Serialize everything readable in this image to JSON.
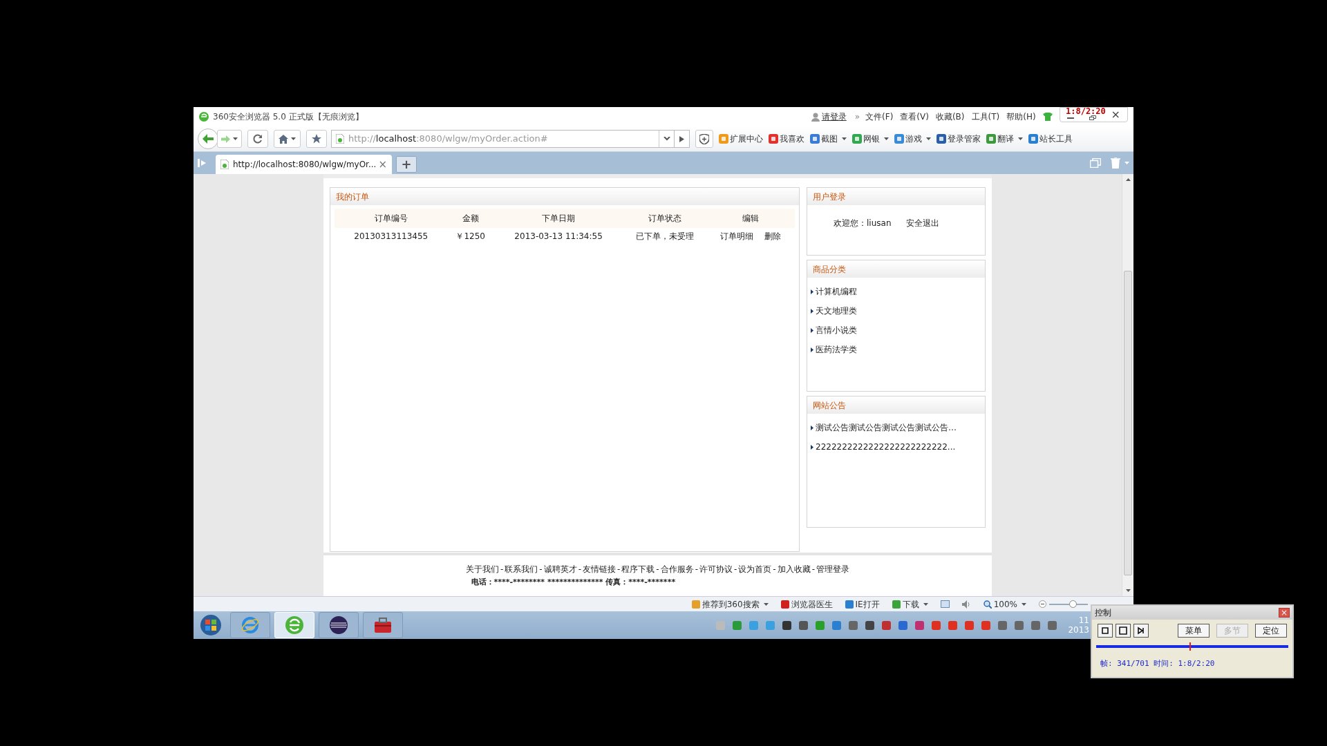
{
  "browser": {
    "title": "360安全浏览器 5.0 正式版【无痕浏览】",
    "login_link": "请登录",
    "overflow": "»",
    "menus": [
      "文件(F)",
      "查看(V)",
      "收藏(B)",
      "工具(T)",
      "帮助(H)"
    ],
    "address": {
      "prefix": "http://",
      "host": "localhost",
      "rest": ":8080/wlgw/myOrder.action#"
    },
    "toolbar": [
      {
        "label": "扩展中心",
        "dropdown": false
      },
      {
        "label": "我喜欢",
        "dropdown": false
      },
      {
        "label": "截图",
        "dropdown": true
      },
      {
        "label": "网银",
        "dropdown": true
      },
      {
        "label": "游戏",
        "dropdown": true
      },
      {
        "label": "登录管家",
        "dropdown": false
      },
      {
        "label": "翻译",
        "dropdown": true
      },
      {
        "label": "站长工具",
        "dropdown": false
      }
    ],
    "tabs": [
      {
        "label": "http://localhost:8080/wlgw/myOr...",
        "selected": true
      }
    ],
    "close_glyph": "×",
    "new_tab_glyph": "+"
  },
  "orders": {
    "title": "我的订单",
    "columns": [
      "订单编号",
      "金额",
      "下单日期",
      "订单状态",
      "编辑"
    ],
    "rows": [
      {
        "id": "20130313113455",
        "amount": "￥1250",
        "date": "2013-03-13 11:34:55",
        "status": "已下单，未受理",
        "actions": [
          "订单明细",
          "删除"
        ]
      }
    ]
  },
  "login": {
    "title": "用户登录",
    "welcome": "欢迎您：liusan",
    "logout": "安全退出"
  },
  "categories": {
    "title": "商品分类",
    "items": [
      "计算机编程",
      "天文地理类",
      "言情小说类",
      "医药法学类"
    ]
  },
  "notices": {
    "title": "网站公告",
    "items": [
      "测试公告测试公告测试公告测试公告…",
      "2222222222222222222222222..."
    ]
  },
  "footer": {
    "separator": "-",
    "links": [
      "关于我们",
      "联系我们",
      "诚聘英才",
      "友情链接",
      "程序下载",
      "合作服务",
      "许可协议",
      "设为首页",
      "加入收藏",
      "管理登录"
    ],
    "contact": "电话：****-******** ************** 传真：****-*******"
  },
  "status_bar": {
    "items": [
      "推荐到360搜索",
      "浏览器医生",
      "IE打开",
      "下载"
    ],
    "zoom": "100%",
    "zoom_level": {
      "level": 0.6
    }
  },
  "taskbar": {
    "apps": [
      {
        "kind": "ie",
        "selected": false
      },
      {
        "kind": "browser360",
        "selected": true
      },
      {
        "kind": "eclipse",
        "selected": false
      },
      {
        "kind": "toolbox",
        "selected": false
      }
    ],
    "clock": [
      "11",
      "2013"
    ]
  },
  "recorder": {
    "overlay_time": "1:8/2:20",
    "title": "控制",
    "close_glyph": "×",
    "buttons": [
      {
        "label": "菜单",
        "disabled": false
      },
      {
        "label": "多节",
        "disabled": true
      },
      {
        "label": "定位",
        "disabled": false
      }
    ],
    "progress": {
      "level": 0.486
    },
    "status": "帧: 341/701 时间: 1:8/2:20"
  }
}
